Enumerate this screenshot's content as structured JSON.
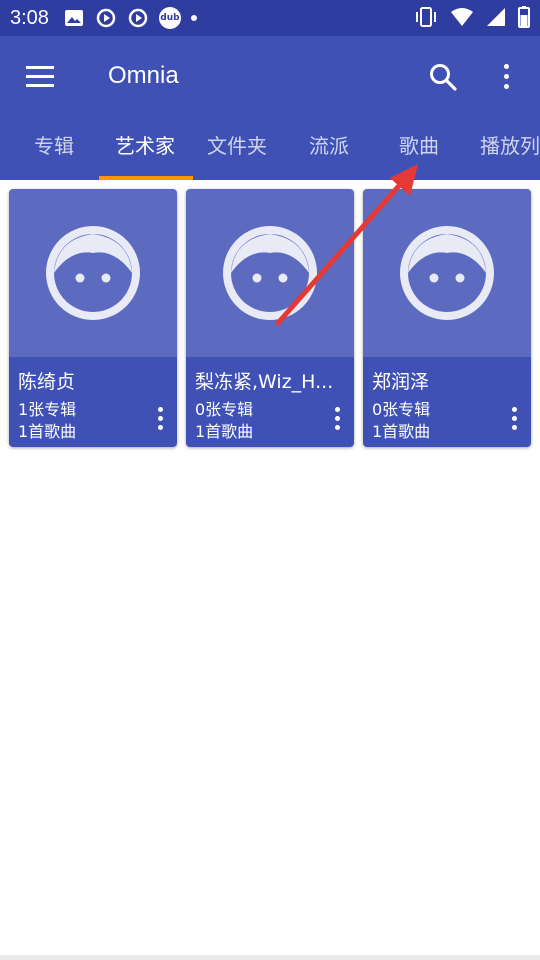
{
  "status_bar": {
    "time": "3:08",
    "left_icons": [
      "image-icon",
      "sync-play-icon",
      "sync-play-icon",
      "dub-icon",
      "notification-dot"
    ],
    "dub_label": "dub",
    "right_icons": [
      "vibrate-icon",
      "wifi-icon",
      "signal-icon",
      "battery-icon"
    ]
  },
  "app_bar": {
    "title": "Omnia",
    "menu_icon": "hamburger-menu-icon",
    "search_icon": "search-icon",
    "more_icon": "more-vert-icon"
  },
  "tabs": [
    {
      "label": "专辑",
      "active": false
    },
    {
      "label": "艺术家",
      "active": true
    },
    {
      "label": "文件夹",
      "active": false
    },
    {
      "label": "流派",
      "active": false
    },
    {
      "label": "歌曲",
      "active": false
    },
    {
      "label": "播放列表",
      "active": false
    }
  ],
  "artists": [
    {
      "name": "陈绮贞",
      "albums": "1张专辑",
      "songs": "1首歌曲"
    },
    {
      "name": "梨冻紧,Wiz_H...",
      "albums": "0张专辑",
      "songs": "1首歌曲"
    },
    {
      "name": "郑润泽",
      "albums": "0张专辑",
      "songs": "1首歌曲"
    }
  ],
  "colors": {
    "status_bar": "#2f3ca0",
    "primary": "#3f51b5",
    "card_art": "#5c6bc0",
    "tab_indicator": "#ff9800",
    "annotation_arrow": "#e53935"
  }
}
